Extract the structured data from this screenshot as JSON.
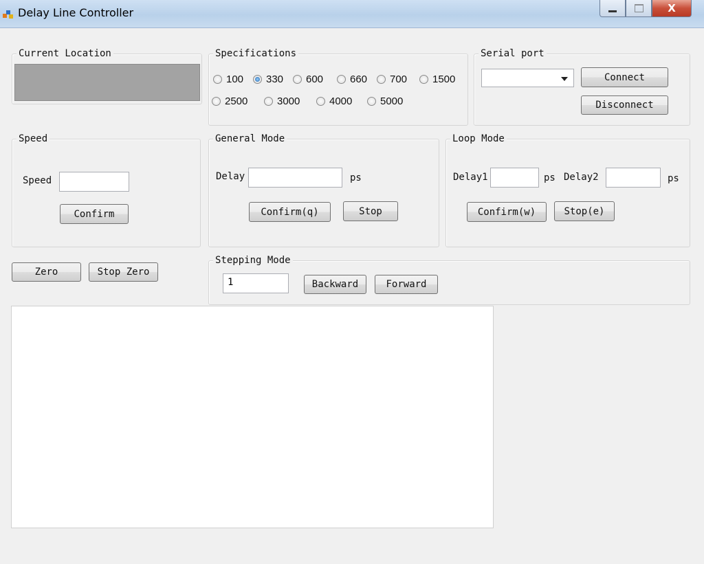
{
  "window": {
    "title": "Delay Line Controller",
    "close_label": "X"
  },
  "current_location": {
    "title": "Current Location",
    "value": ""
  },
  "specifications": {
    "title": "Specifications",
    "options": [
      "100",
      "330",
      "600",
      "660",
      "700",
      "1500",
      "2500",
      "3000",
      "4000",
      "5000"
    ],
    "selected": "330"
  },
  "serial_port": {
    "title": "Serial port",
    "selected_port": "",
    "connect_label": "Connect",
    "disconnect_label": "Disconnect"
  },
  "speed": {
    "title": "Speed",
    "speed_label": "Speed",
    "speed_value": "",
    "confirm_label": "Confirm"
  },
  "general_mode": {
    "title": "General Mode",
    "delay_label": "Delay",
    "delay_value": "",
    "unit": "ps",
    "confirm_label": "Confirm(q)",
    "stop_label": "Stop"
  },
  "loop_mode": {
    "title": "Loop Mode",
    "delay1_label": "Delay1",
    "delay1_value": "",
    "delay1_unit": "ps",
    "delay2_label": "Delay2",
    "delay2_value": "",
    "delay2_unit": "ps",
    "confirm_label": "Confirm(w)",
    "stop_label": "Stop(e)"
  },
  "zero": {
    "zero_label": "Zero",
    "stop_zero_label": "Stop Zero"
  },
  "stepping_mode": {
    "title": "Stepping Mode",
    "step_value": "1",
    "backward_label": "Backward",
    "forward_label": "Forward"
  },
  "log": {
    "text": ""
  },
  "colors": {
    "window_bg": "#f0f0f0",
    "location_bg": "#a3a3a3",
    "close_button": "#c9503a"
  }
}
